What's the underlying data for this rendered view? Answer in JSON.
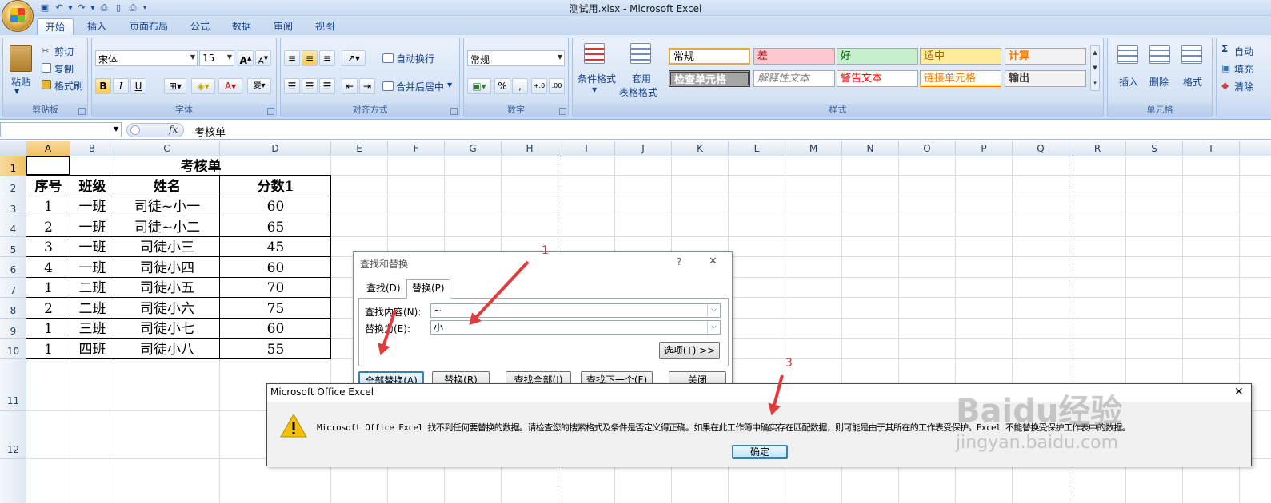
{
  "window": {
    "title": "测试用.xlsx - Microsoft Excel"
  },
  "tabs": [
    "开始",
    "插入",
    "页面布局",
    "公式",
    "数据",
    "审阅",
    "视图"
  ],
  "ribbon": {
    "clipboard": {
      "paste": "粘贴",
      "cut": "剪切",
      "copy": "复制",
      "format_painter": "格式刷",
      "label": "剪贴板"
    },
    "font": {
      "name": "宋体",
      "size": "15",
      "bold": "B",
      "italic": "I",
      "underline": "U",
      "label": "字体"
    },
    "alignment": {
      "wrap": "自动换行",
      "merge": "合并后居中",
      "label": "对齐方式"
    },
    "number": {
      "format": "常规",
      "percent": "%",
      "comma": ",",
      "label": "数字"
    },
    "styles": {
      "conditional": "条件格式",
      "table_line1": "套用",
      "table_line2": "表格格式",
      "cells": [
        {
          "text": "常规",
          "bg": "#ffffff",
          "color": "#000000"
        },
        {
          "text": "差",
          "bg": "#ffc7ce",
          "color": "#9c0006"
        },
        {
          "text": "好",
          "bg": "#c6efce",
          "color": "#006100"
        },
        {
          "text": "适中",
          "bg": "#ffeb9c",
          "color": "#9c6500"
        },
        {
          "text": "计算",
          "bg": "#f2f2f2",
          "color": "#fa7d00"
        },
        {
          "text": "检查单元格",
          "bg": "#a5a5a5",
          "color": "#ffffff"
        },
        {
          "text": "解释性文本",
          "bg": "#ffffff",
          "color": "#7f7f7f"
        },
        {
          "text": "警告文本",
          "bg": "#ffffff",
          "color": "#ff0000"
        },
        {
          "text": "链接单元格",
          "bg": "#ffffff",
          "color": "#fa7d00"
        },
        {
          "text": "输出",
          "bg": "#f2f2f2",
          "color": "#3f3f3f"
        }
      ],
      "label": "样式"
    },
    "cells_group": {
      "insert": "插入",
      "delete": "删除",
      "format": "格式",
      "label": "单元格"
    },
    "editing": {
      "autosum": "自动",
      "fill": "填充",
      "clear": "清除"
    }
  },
  "formula_bar": {
    "name_box": "",
    "fx": "fx",
    "content": "考核单"
  },
  "columns": [
    "A",
    "B",
    "C",
    "D",
    "E",
    "F",
    "G",
    "H",
    "I",
    "J",
    "K",
    "L",
    "M",
    "N",
    "O",
    "P",
    "Q",
    "R",
    "S",
    "T"
  ],
  "rows": [
    "1",
    "2",
    "3",
    "4",
    "5",
    "6",
    "7",
    "8",
    "9",
    "10",
    "11",
    "12"
  ],
  "sheet": {
    "title": "考核单",
    "headers": [
      "序号",
      "班级",
      "姓名",
      "分数1"
    ],
    "data": [
      [
        "1",
        "一班",
        "司徒~小一",
        "60"
      ],
      [
        "2",
        "一班",
        "司徒~小二",
        "65"
      ],
      [
        "3",
        "一班",
        "司徒小三",
        "45"
      ],
      [
        "4",
        "一班",
        "司徒小四",
        "60"
      ],
      [
        "1",
        "二班",
        "司徒小五",
        "70"
      ],
      [
        "2",
        "二班",
        "司徒小六",
        "75"
      ],
      [
        "1",
        "三班",
        "司徒小七",
        "60"
      ],
      [
        "1",
        "四班",
        "司徒小八",
        "55"
      ]
    ]
  },
  "find_replace": {
    "title": "查找和替换",
    "help": "?",
    "close": "✕",
    "tab_find": "查找(D)",
    "tab_replace": "替换(P)",
    "find_label": "查找内容(N):",
    "find_value": "~",
    "replace_label": "替换为(E):",
    "replace_value": "小",
    "options": "选项(T) >>",
    "replace_all": "全部替换(A)",
    "replace": "替换(R)",
    "find_all": "查找全部(I)",
    "find_next": "查找下一个(F)",
    "close_btn": "关闭"
  },
  "message": {
    "title": "Microsoft Office Excel",
    "close": "✕",
    "text": "Microsoft Office Excel 找不到任何要替换的数据。请检查您的搜索格式及条件是否定义得正确。如果在此工作簿中确实存在匹配数据，则可能是由于其所在的工作表受保护。Excel 不能替换受保护工作表中的数据。",
    "ok": "确定"
  },
  "annotations": [
    "1",
    "3"
  ],
  "watermark": {
    "line1": "Baidu经验",
    "line2": "jingyan.baidu.com"
  }
}
